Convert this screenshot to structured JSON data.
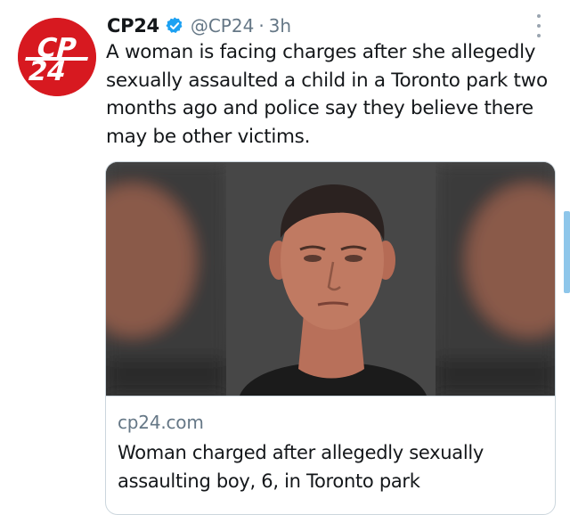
{
  "tweet": {
    "author_name": "CP24",
    "handle": "@CP24",
    "separator": "·",
    "time": "3h",
    "text": "A woman is facing charges after she allegedly sexually assaulted a child in a Toronto park two months ago and police say they believe there may be other victims.",
    "verified": true
  },
  "avatar": {
    "logo_top": "CP",
    "logo_bottom": "24",
    "brand_color": "#d71920"
  },
  "card": {
    "domain": "cp24.com",
    "title": "Woman charged after allegedly sexually assaulting boy, 6, in Toronto park"
  },
  "icons": {
    "verified": "verified-badge-icon",
    "more": "more-vertical-icon"
  },
  "colors": {
    "text": "#14171a",
    "secondary": "#657786",
    "verified": "#1da1f2",
    "border": "#ccd6dd",
    "scrollbar": "#8ec6ea"
  }
}
